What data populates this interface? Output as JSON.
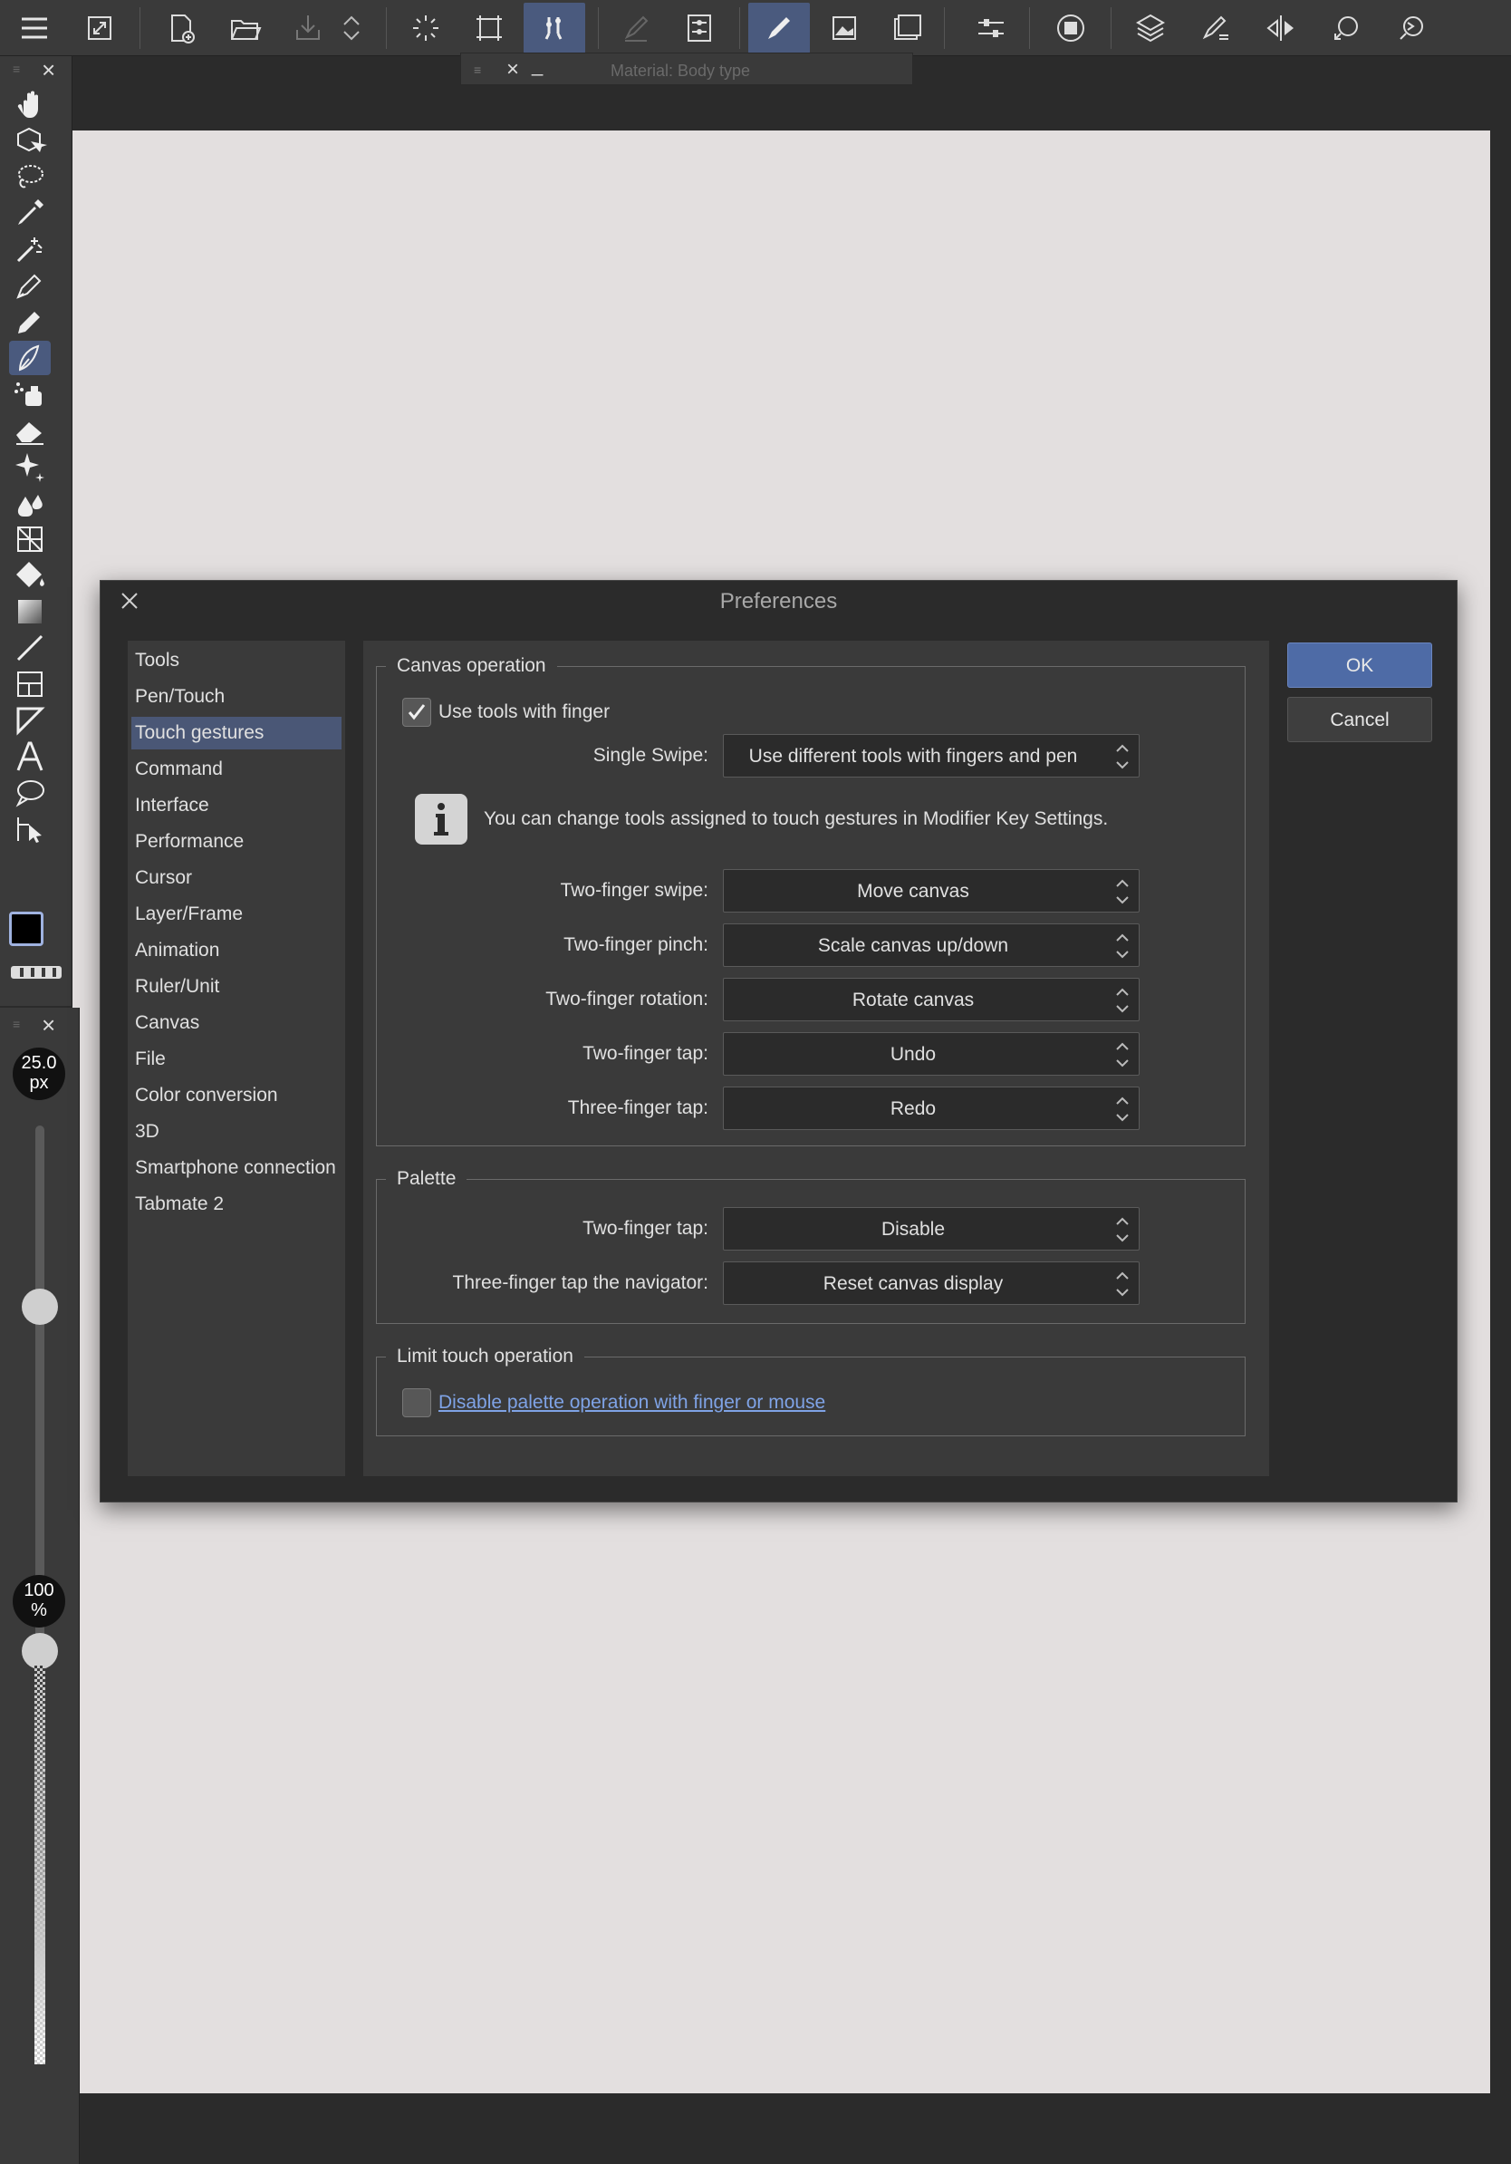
{
  "floating_palette": {
    "title": "Material: Body type"
  },
  "brush_size": {
    "value": "25.0",
    "unit": "px"
  },
  "opacity": {
    "value": "100",
    "unit": "%"
  },
  "colors": {
    "main": "#000000",
    "sub": "#b8386a",
    "accent": "#4a5a7e"
  },
  "dialog": {
    "title": "Preferences",
    "categories": [
      "Tools",
      "Pen/Touch",
      "Touch gestures",
      "Command",
      "Interface",
      "Performance",
      "Cursor",
      "Layer/Frame",
      "Animation",
      "Ruler/Unit",
      "Canvas",
      "File",
      "Color conversion",
      "3D",
      "Smartphone connection",
      "Tabmate 2"
    ],
    "selected_category": "Touch gestures",
    "canvas_operation": {
      "title": "Canvas operation",
      "use_tools_with_finger": {
        "label": "Use tools with finger",
        "checked": true
      },
      "single_swipe": {
        "label": "Single Swipe:",
        "value": "Use different tools with fingers and pen"
      },
      "info": "You can change tools assigned to touch gestures in Modifier Key Settings.",
      "two_finger_swipe": {
        "label": "Two-finger swipe:",
        "value": "Move canvas"
      },
      "two_finger_pinch": {
        "label": "Two-finger pinch:",
        "value": "Scale canvas up/down"
      },
      "two_finger_rotation": {
        "label": "Two-finger rotation:",
        "value": "Rotate canvas"
      },
      "two_finger_tap": {
        "label": "Two-finger tap:",
        "value": "Undo"
      },
      "three_finger_tap": {
        "label": "Three-finger tap:",
        "value": "Redo"
      }
    },
    "palette": {
      "title": "Palette",
      "two_finger_tap": {
        "label": "Two-finger tap:",
        "value": "Disable"
      },
      "three_finger_tap_navigator": {
        "label": "Three-finger tap the navigator:",
        "value": "Reset canvas display"
      }
    },
    "limit_touch": {
      "title": "Limit touch operation",
      "disable_palette": {
        "label": "Disable palette operation with finger or mouse",
        "checked": false
      }
    },
    "ok_label": "OK",
    "cancel_label": "Cancel"
  }
}
